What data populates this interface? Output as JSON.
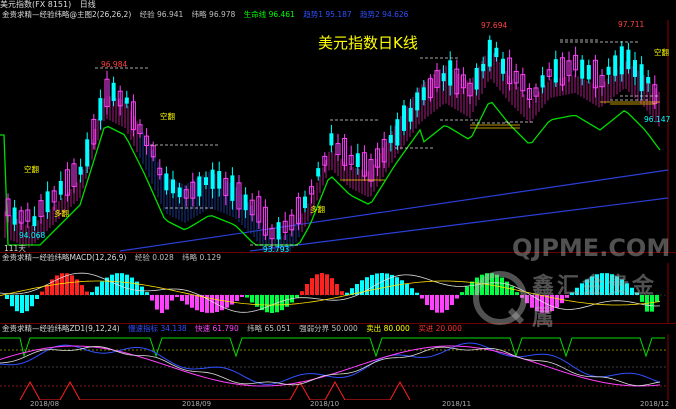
{
  "window": {
    "title": "美元指数(FX 8151)",
    "period": "日线"
  },
  "chart_title": "美元指数日K线",
  "main_panel": {
    "indicator": "金贵求精—经验纬略@主图2(26,26,2)",
    "items": [
      {
        "label": "经验 96.941",
        "color": "#c0c0c0"
      },
      {
        "label": "纬略 96.978",
        "color": "#c0c0c0"
      },
      {
        "label": "生命线 96.461",
        "color": "#00ff00"
      },
      {
        "label": "趋势1 95.187",
        "color": "#3050ff"
      },
      {
        "label": "趋势2 94.626",
        "color": "#3050ff"
      }
    ],
    "price_labels": [
      {
        "text": "96.984",
        "color": "#ff4040"
      },
      {
        "text": "97.694",
        "color": "#ff4040"
      },
      {
        "text": "97.711",
        "color": "#ff4040"
      },
      {
        "text": "94.068",
        "color": "#00ffff"
      },
      {
        "text": "93.793",
        "color": "#00ffff"
      },
      {
        "text": "96.147",
        "color": "#00ffff"
      }
    ],
    "signals": [
      "空翻",
      "空翻",
      "多翻",
      "多翻",
      "空翻"
    ],
    "day_count": "111天"
  },
  "macd_panel": {
    "indicator": "金贵求精—经验纬略MACD(12,26,9)",
    "items": [
      {
        "label": "经验 0.028",
        "color": "#c0c0c0"
      },
      {
        "label": "纬略 0.129",
        "color": "#c0c0c0"
      }
    ]
  },
  "zd_panel": {
    "indicator": "金贵求精—经验纬略ZD1(9,12,24)",
    "items": [
      {
        "label": "慢速指标 34.138",
        "color": "#3050ff"
      },
      {
        "label": "快速 61.790",
        "color": "#ff40ff"
      },
      {
        "label": "纬略 65.051",
        "color": "#c0c0c0"
      },
      {
        "label": "强弱分界 50.000",
        "color": "#c0c0c0"
      },
      {
        "label": "卖出 80.000",
        "color": "#ffff00"
      },
      {
        "label": "买进 20.000",
        "color": "#ff3030"
      }
    ]
  },
  "date_axis": [
    "2018/08",
    "2018/09",
    "2018/10",
    "2018/11",
    "2018/12"
  ],
  "watermark": {
    "line1": "QJPME.COM",
    "line2": "鑫汇金贵金属"
  },
  "colors": {
    "up": "#ff40ff",
    "down": "#00ffff",
    "life_line": "#00dd00",
    "trend": "#2a3fd8"
  }
}
